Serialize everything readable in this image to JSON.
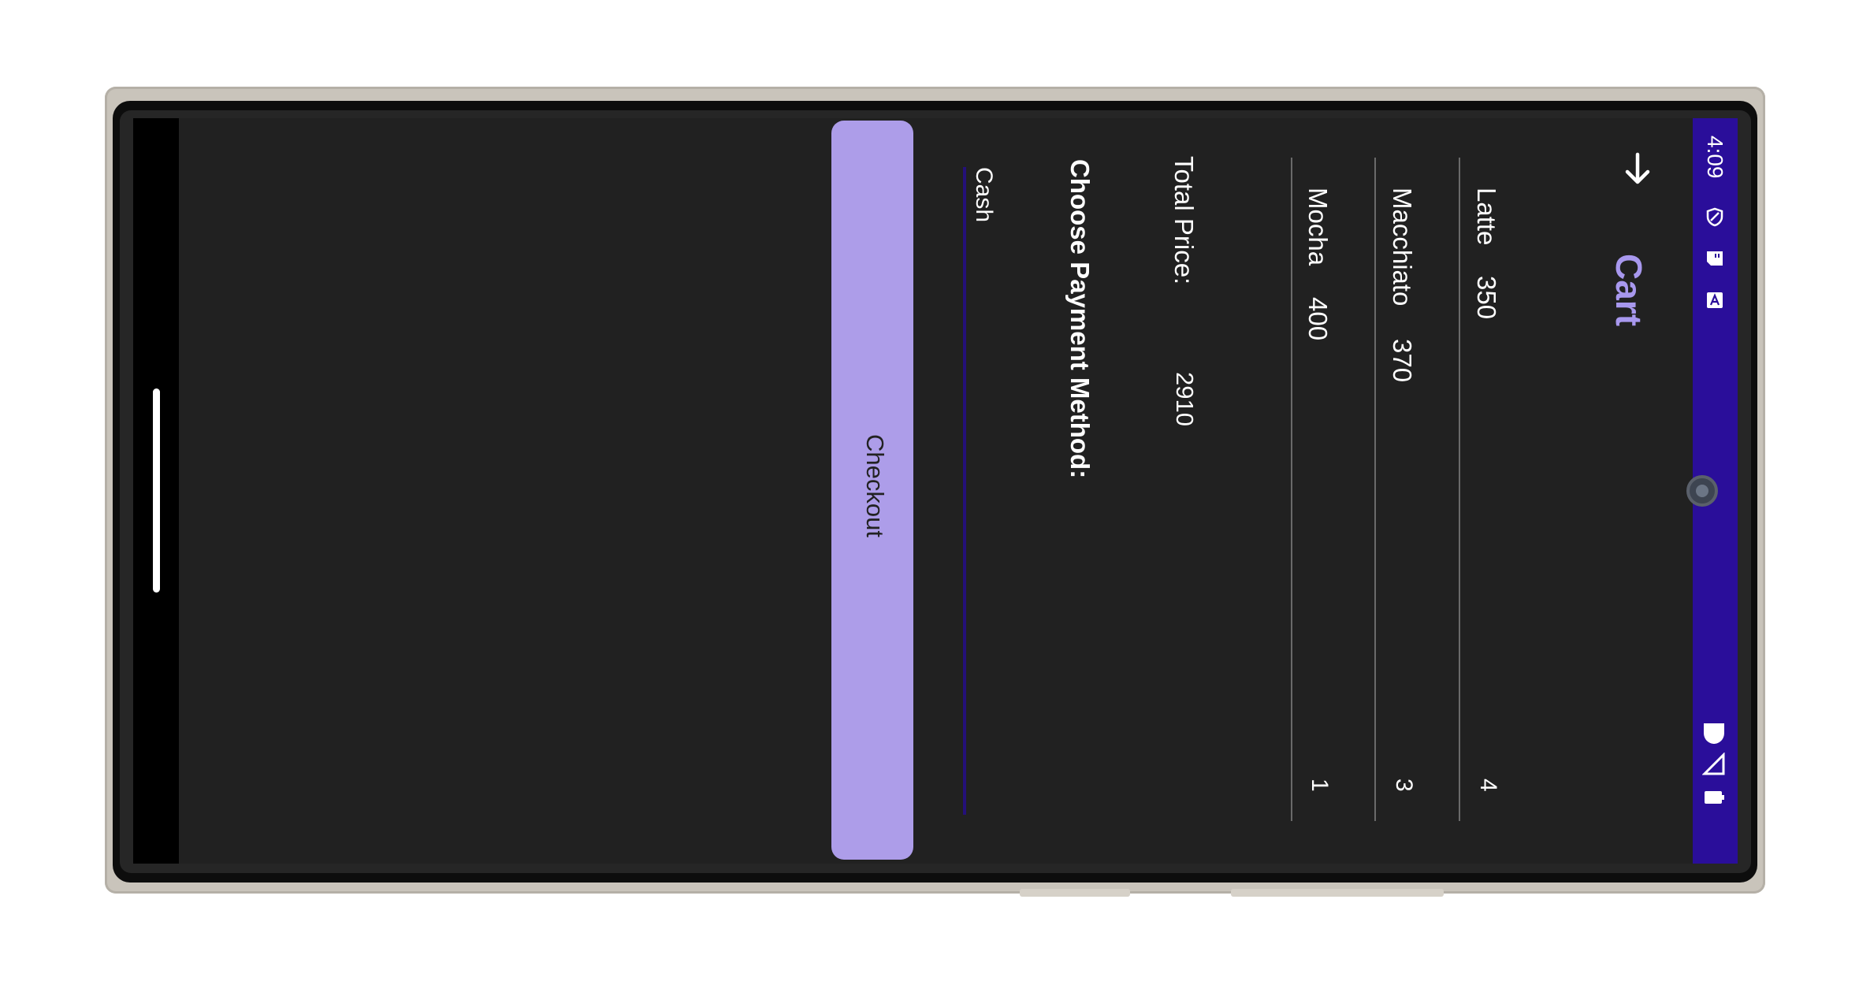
{
  "status_bar": {
    "time": "4:09",
    "left_icons": [
      "shield-icon",
      "sd-card-icon",
      "font-a-icon"
    ],
    "right_icons": [
      "wifi-icon",
      "cellular-signal-icon",
      "battery-icon"
    ]
  },
  "header": {
    "title": "Cart",
    "back_icon": "arrow-back-icon"
  },
  "cart_items": [
    {
      "name": "Latte",
      "price": "350",
      "quantity": "4"
    },
    {
      "name": "Macchiato",
      "price": "370",
      "quantity": "3"
    },
    {
      "name": "Mocha",
      "price": "400",
      "quantity": "1"
    }
  ],
  "total": {
    "label": "Total Price:",
    "value": "2910"
  },
  "payment": {
    "label": "Choose Payment Method:",
    "selected": "Cash"
  },
  "checkout": {
    "label": "Checkout"
  },
  "colors": {
    "status_bar": "#2a0e9a",
    "accent": "#a898ee",
    "button": "#ad9de9",
    "background": "#212121"
  }
}
